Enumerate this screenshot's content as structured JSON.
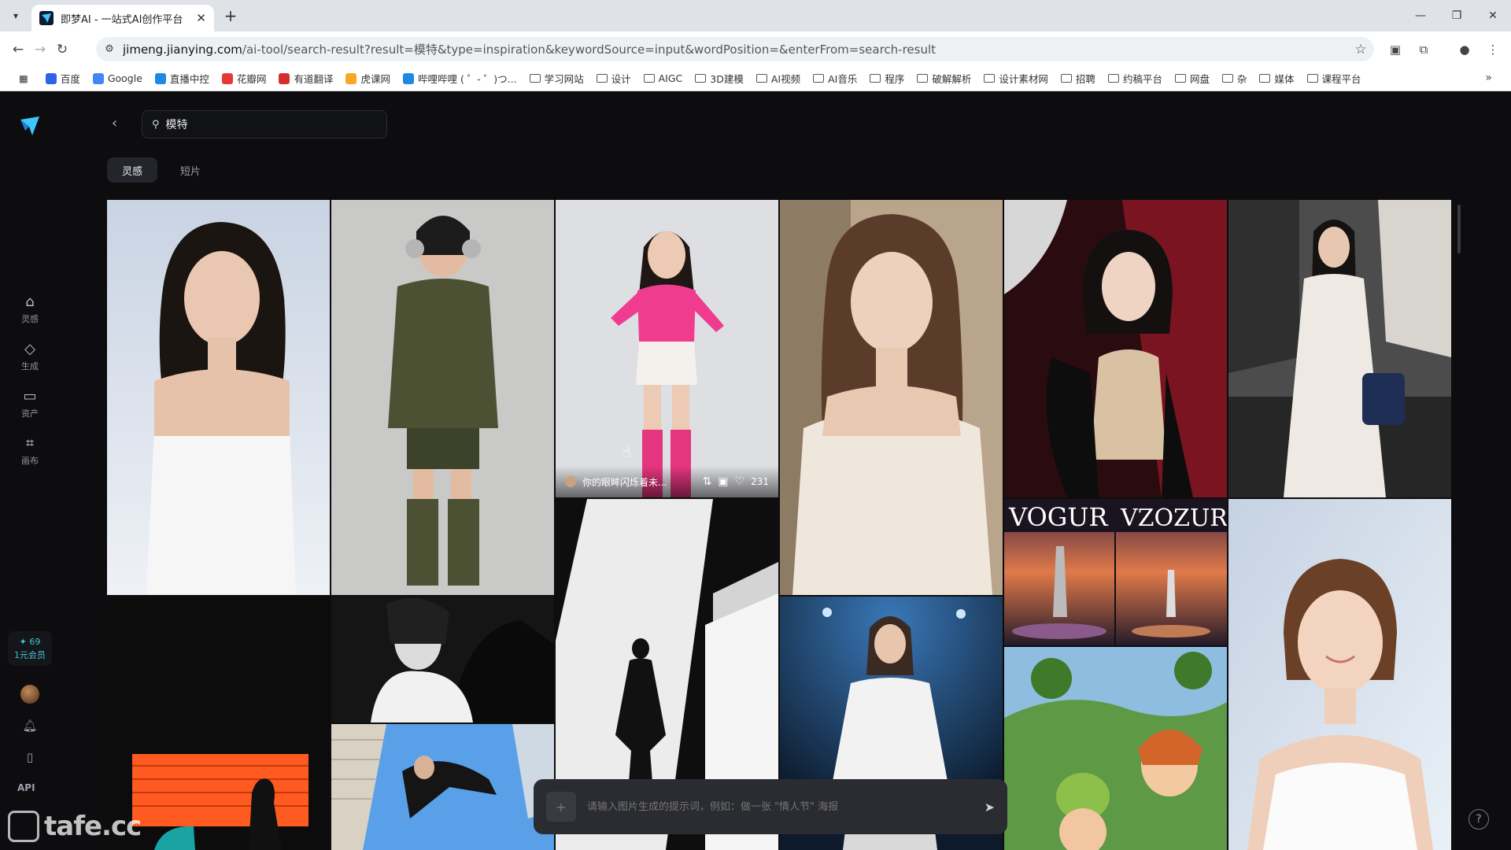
{
  "browser": {
    "tab_title": "即梦AI - 一站式AI创作平台",
    "url_host": "jimeng.jianying.com",
    "url_path": "/ai-tool/search-result?result=模特&type=inspiration&keywordSource=input&wordPosition=&enterFrom=search-result",
    "bookmarks": [
      {
        "label": "百度",
        "color": "#2d64e6"
      },
      {
        "label": "Google",
        "color": "#4285f4"
      },
      {
        "label": "直播中控",
        "color": "#1e88e5"
      },
      {
        "label": "花瓣网",
        "color": "#e53935"
      },
      {
        "label": "有道翻译",
        "color": "#d32f2f"
      },
      {
        "label": "虎课网",
        "color": "#f9a825"
      },
      {
        "label": "哔哩哔哩 ( ゜- ゜)つ...",
        "color": "#1e88e5"
      },
      {
        "label": "学习网站",
        "folder": true
      },
      {
        "label": "设计",
        "folder": true
      },
      {
        "label": "AIGC",
        "folder": true
      },
      {
        "label": "3D建模",
        "folder": true
      },
      {
        "label": "AI视频",
        "folder": true
      },
      {
        "label": "AI音乐",
        "folder": true
      },
      {
        "label": "程序",
        "folder": true
      },
      {
        "label": "破解解析",
        "folder": true
      },
      {
        "label": "设计素材网",
        "folder": true
      },
      {
        "label": "招聘",
        "folder": true
      },
      {
        "label": "约稿平台",
        "folder": true
      },
      {
        "label": "网盘",
        "folder": true
      },
      {
        "label": "杂",
        "folder": true
      },
      {
        "label": "媒体",
        "folder": true
      },
      {
        "label": "课程平台",
        "folder": true
      }
    ]
  },
  "sidebar": {
    "items": [
      {
        "label": "灵感",
        "icon": "home-icon"
      },
      {
        "label": "生成",
        "icon": "diamond-icon"
      },
      {
        "label": "资产",
        "icon": "folder-icon"
      },
      {
        "label": "画布",
        "icon": "canvas-icon"
      }
    ],
    "points": "✦ 69",
    "membership": "1元会员",
    "api": "API"
  },
  "search": {
    "value": "模特"
  },
  "tabs": [
    {
      "label": "灵感",
      "active": true
    },
    {
      "label": "短片",
      "active": false
    }
  ],
  "gallery": {
    "hover_card": {
      "user": "你的眼眸闪烁着未...",
      "likes": "231"
    }
  },
  "prompt": {
    "placeholder": "请输入图片生成的提示词，例如：做一张 \"情人节\" 海报"
  },
  "watermark": "tafe.cc",
  "colors": {
    "accent": "#48c1d6",
    "background": "#0d0d0f"
  }
}
